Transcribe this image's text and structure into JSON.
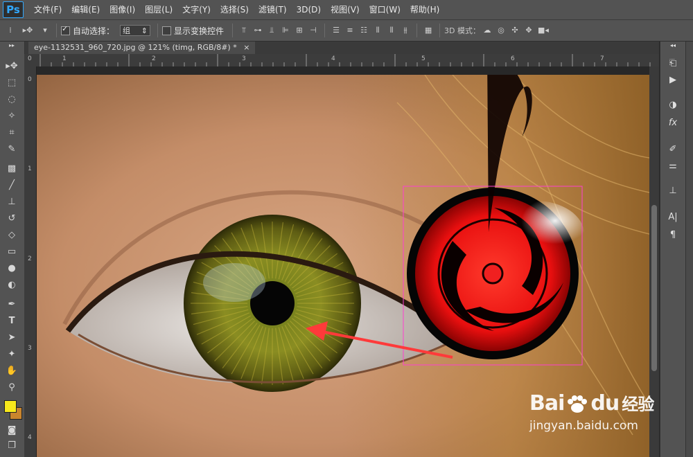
{
  "app": {
    "logo": "Ps"
  },
  "menu": [
    "文件(F)",
    "编辑(E)",
    "图像(I)",
    "图层(L)",
    "文字(Y)",
    "选择(S)",
    "滤镜(T)",
    "3D(D)",
    "视图(V)",
    "窗口(W)",
    "帮助(H)"
  ],
  "options": {
    "auto_select_label": "自动选择：",
    "auto_select_value": "组",
    "show_transform_label": "显示变换控件",
    "mode_3d_label": "3D 模式："
  },
  "document": {
    "tab_title": "eye-1132531_960_720.jpg @ 121% (timg, RGB/8#) *",
    "close": "×"
  },
  "rulers": {
    "top": [
      "0",
      "1",
      "2",
      "3",
      "4",
      "5",
      "6",
      "7"
    ],
    "left": [
      "0",
      "1",
      "2",
      "3",
      "4"
    ]
  },
  "watermark": {
    "brand_a": "Bai",
    "brand_b": "du",
    "brand_c": "经验",
    "url": "jingyan.baidu.com"
  },
  "colors": {
    "foreground": "#f7e81c",
    "background": "#c9852d",
    "accent": "#31a8ff",
    "selection": "#ff3fd0"
  }
}
